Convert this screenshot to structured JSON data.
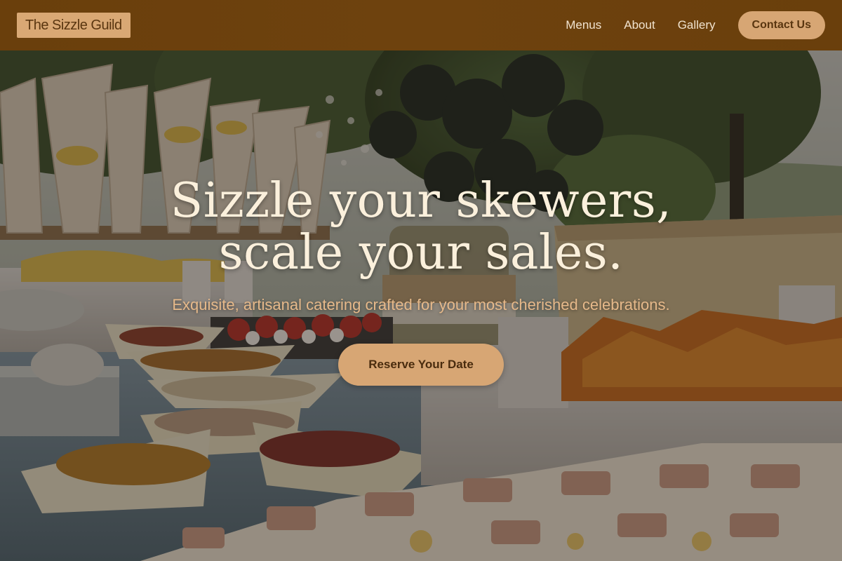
{
  "header": {
    "logo_text": "The Sizzle Guild",
    "nav": [
      {
        "label": "Menus"
      },
      {
        "label": "About"
      },
      {
        "label": "Gallery"
      }
    ],
    "contact_label": "Contact Us"
  },
  "hero": {
    "title": "Sizzle your skewers, scale your sales.",
    "subtitle": "Exquisite, artisanal catering crafted for your most cherished celebrations.",
    "cta_label": "Reserve Your Date"
  },
  "colors": {
    "header_bg": "#6a3f0c",
    "accent": "#d7a674",
    "accent_text": "#5a3610",
    "title_text": "#fbf0dc",
    "subtitle_text": "#e6b98a"
  }
}
